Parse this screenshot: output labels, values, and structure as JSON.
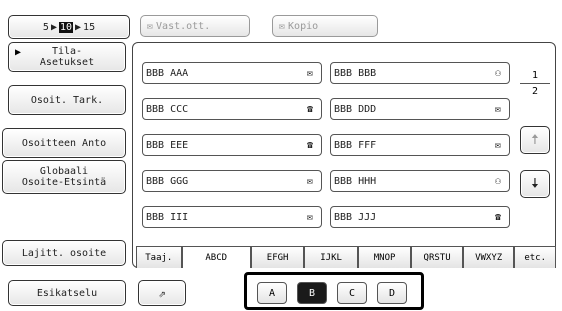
{
  "pager": {
    "prev": "5",
    "current": "10",
    "next": "15"
  },
  "toolbar": {
    "to_label": "Vast.ott.",
    "cc_label": "Kopio"
  },
  "sidebar": {
    "items": [
      {
        "label_line1": "Tila-",
        "label_line2": "Asetukset"
      },
      {
        "label": "Osoit. Tark."
      },
      {
        "label": "Osoitteen Anto"
      },
      {
        "label_line1": "Globaali",
        "label_line2": "Osoite-Etsintä"
      }
    ],
    "sort_label": "Lajitt. osoite",
    "preview_label": "Esikatselu"
  },
  "entries": [
    {
      "name": "BBB AAA",
      "icon": "email-icon"
    },
    {
      "name": "BBB BBB",
      "icon": "group-icon"
    },
    {
      "name": "BBB CCC",
      "icon": "fax-icon"
    },
    {
      "name": "BBB DDD",
      "icon": "email-icon"
    },
    {
      "name": "BBB EEE",
      "icon": "fax-icon"
    },
    {
      "name": "BBB FFF",
      "icon": "email-icon"
    },
    {
      "name": "BBB GGG",
      "icon": "email-icon"
    },
    {
      "name": "BBB HHH",
      "icon": "group-icon"
    },
    {
      "name": "BBB III",
      "icon": "email-icon"
    },
    {
      "name": "BBB JJJ",
      "icon": "fax-icon"
    }
  ],
  "page": {
    "current": "1",
    "total": "2"
  },
  "tabs": [
    "Taaj.",
    "ABCD",
    "EFGH",
    "IJKL",
    "MNOP",
    "QRSTU",
    "VWXYZ",
    "etc."
  ],
  "active_tab": "ABCD",
  "letters": [
    "A",
    "B",
    "C",
    "D"
  ],
  "selected_letter": "B"
}
